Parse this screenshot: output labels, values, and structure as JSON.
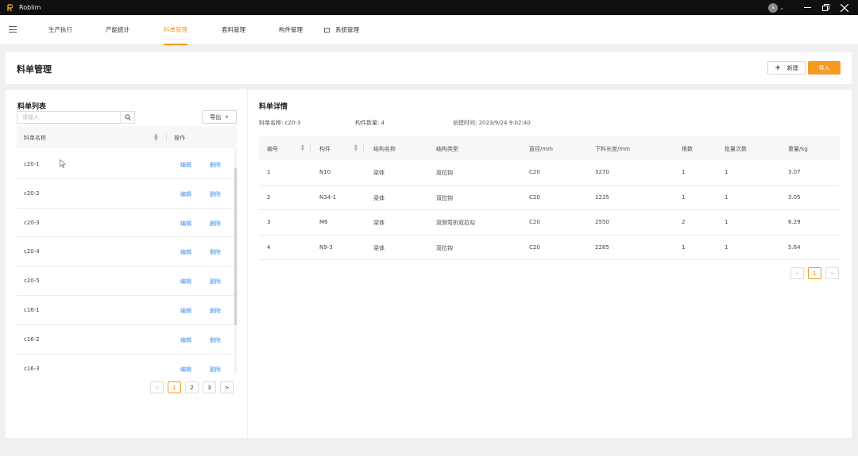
{
  "app": {
    "name": "Roblim",
    "avatar_letter": "s"
  },
  "nav": {
    "items": [
      {
        "label": "生产执行"
      },
      {
        "label": "产能统计"
      },
      {
        "label": "料单管理"
      },
      {
        "label": "套料管理"
      },
      {
        "label": "构件管理"
      },
      {
        "label": "系统管理"
      }
    ],
    "active": "料单管理"
  },
  "header": {
    "title": "料单管理",
    "new_label": "新建",
    "import_label": "导入"
  },
  "left": {
    "title": "料单列表",
    "search_placeholder": "请输入",
    "export_label": "导出",
    "columns": {
      "name": "料单名称",
      "ops": "操作"
    },
    "rows": [
      {
        "name": "c20-1",
        "edit": "编辑",
        "del": "删除"
      },
      {
        "name": "c20-2",
        "edit": "编辑",
        "del": "删除"
      },
      {
        "name": "c20-3",
        "edit": "编辑",
        "del": "删除"
      },
      {
        "name": "c20-4",
        "edit": "编辑",
        "del": "删除"
      },
      {
        "name": "c20-5",
        "edit": "编辑",
        "del": "删除"
      },
      {
        "name": "c16-1",
        "edit": "编辑",
        "del": "删除"
      },
      {
        "name": "c16-2",
        "edit": "编辑",
        "del": "删除"
      },
      {
        "name": "c16-3",
        "edit": "编辑",
        "del": "删除"
      }
    ],
    "pager": {
      "prev": "<",
      "pages": [
        "1",
        "2",
        "3"
      ],
      "current": "1",
      "next": ">"
    }
  },
  "right": {
    "title": "料单详情",
    "meta": {
      "name": "料单名称: c20-3",
      "count": "构件数量: 4",
      "created": "创建时间: 2023/9/24 9:02:40"
    },
    "columns": [
      "编号",
      "构件",
      "结构名称",
      "结构类型",
      "直径/mm",
      "下料长度/mm",
      "根数",
      "批量次数",
      "重量/kg"
    ],
    "rows": [
      [
        "1",
        "N10",
        "梁体",
        "双拉钩",
        "C20",
        "3270",
        "1",
        "1",
        "3.07"
      ],
      [
        "2",
        "N34-1",
        "梁体",
        "双拉钩",
        "C20",
        "1235",
        "1",
        "1",
        "3.05"
      ],
      [
        "3",
        "M6",
        "梁体",
        "双侧弯折双拉勾",
        "C20",
        "2550",
        "2",
        "1",
        "6.29"
      ],
      [
        "4",
        "N9-3",
        "梁体",
        "双拉钩",
        "C20",
        "2285",
        "1",
        "1",
        "5.64"
      ]
    ],
    "pager": {
      "prev": "<",
      "pages": [
        "1"
      ],
      "current": "1",
      "next": ">"
    }
  },
  "colors": {
    "accent": "#f59a23",
    "link": "#3b8ff5",
    "titlebar": "#101010"
  }
}
